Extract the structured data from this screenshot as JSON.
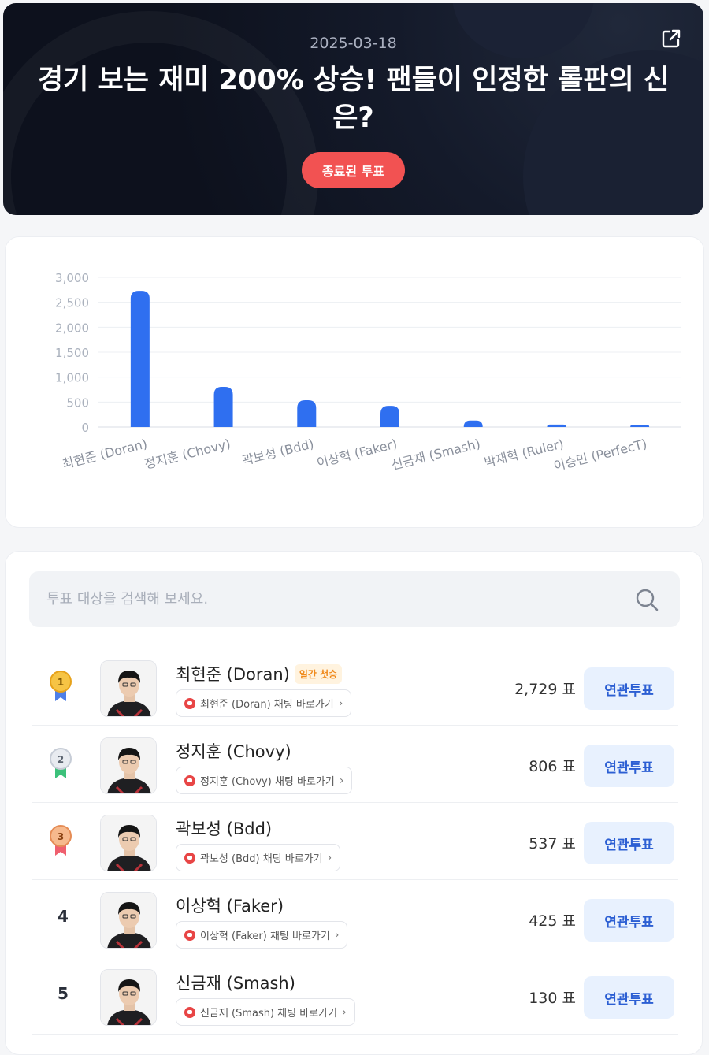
{
  "header": {
    "date": "2025-03-18",
    "title": "경기 보는 재미 200% 상승! 팬들이 인정한 롤판의 신은?",
    "status_badge": "종료된 투표",
    "share_icon": "external-share-icon",
    "colors": {
      "badge": "#f25252",
      "background": "#0d111d"
    }
  },
  "chart_data": {
    "type": "bar",
    "categories": [
      "최현준 (Doran)",
      "정지훈 (Chovy)",
      "곽보성 (Bdd)",
      "이상혁 (Faker)",
      "신금재 (Smash)",
      "박재혁 (Ruler)",
      "이승민 (PerfecT)"
    ],
    "values": [
      2729,
      806,
      537,
      425,
      130,
      50,
      48
    ],
    "ylim": [
      0,
      3000
    ],
    "yticks": [
      "0",
      "500",
      "1,000",
      "1,500",
      "2,000",
      "2,500",
      "3,000"
    ],
    "title": "",
    "xlabel": "",
    "ylabel": "",
    "grid": true,
    "bar_color": "#2f6ff0"
  },
  "search": {
    "placeholder": "투표 대상을 검색해 보세요.",
    "value": ""
  },
  "ranking": {
    "vote_unit": "표",
    "related_label": "연관투표",
    "rows": [
      {
        "rank": "1",
        "medal": "gold",
        "name": "최현준 (Doran)",
        "badge": "일간 첫승",
        "chat": "최현준 (Doran) 채팅 바로가기",
        "votes": "2,729 표"
      },
      {
        "rank": "2",
        "medal": "silver",
        "name": "정지훈 (Chovy)",
        "badge": "",
        "chat": "정지훈 (Chovy) 채팅 바로가기",
        "votes": "806 표"
      },
      {
        "rank": "3",
        "medal": "bronze",
        "name": "곽보성 (Bdd)",
        "badge": "",
        "chat": "곽보성 (Bdd) 채팅 바로가기",
        "votes": "537 표"
      },
      {
        "rank": "4",
        "medal": "",
        "name": "이상혁 (Faker)",
        "badge": "",
        "chat": "이상혁 (Faker) 채팅 바로가기",
        "votes": "425 표"
      },
      {
        "rank": "5",
        "medal": "",
        "name": "신금재 (Smash)",
        "badge": "",
        "chat": "신금재 (Smash) 채팅 바로가기",
        "votes": "130 표"
      }
    ]
  }
}
